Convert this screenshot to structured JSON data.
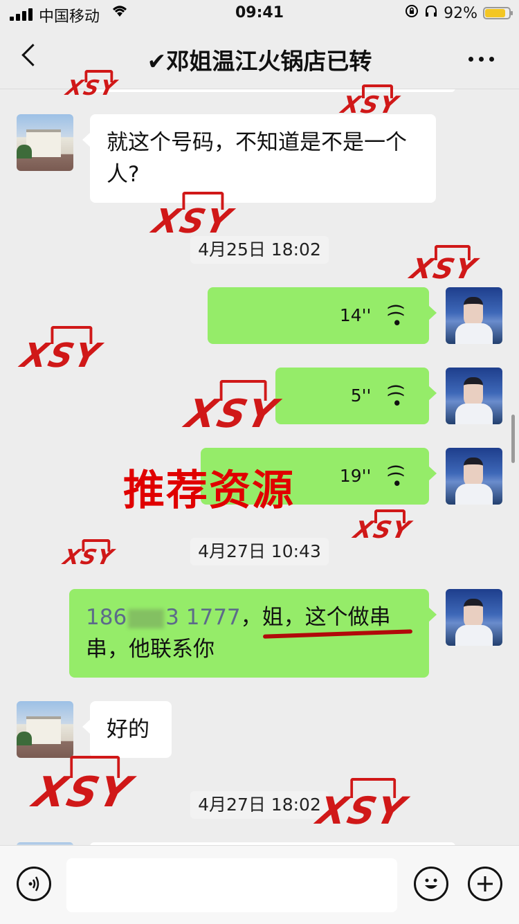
{
  "status_bar": {
    "carrier": "中国移动",
    "time": "09:41",
    "battery_percent": "92%",
    "battery_level": 0.92,
    "wifi_icon": "wifi-icon",
    "lock_icon": "rotation-lock-icon",
    "headphones_icon": "headphones-icon"
  },
  "nav": {
    "title": "✔邓姐温江火锅店已转"
  },
  "messages": [
    {
      "side": "in",
      "text": "就这个号码，不知道是不是一个人?"
    },
    {
      "timestamp": "4月25日 18:02"
    },
    {
      "side": "out",
      "type": "voice",
      "duration": "14''"
    },
    {
      "side": "out",
      "type": "voice",
      "duration": "5''"
    },
    {
      "side": "out",
      "type": "voice",
      "duration": "19''"
    },
    {
      "timestamp": "4月27日 10:43"
    },
    {
      "side": "out",
      "phone_prefix": "186",
      "phone_suffix": "3 1777",
      "text": "，姐，这个做串串，他联系你"
    },
    {
      "side": "in",
      "text": "好的"
    },
    {
      "timestamp": "4月27日 18:02"
    }
  ],
  "overlay": {
    "text": "推荐资源"
  },
  "watermark": {
    "text": "XSY",
    "color": "#d01818"
  },
  "input_bar": {
    "voice_button_icon": "voice-input-icon",
    "emoji_button_icon": "emoji-icon",
    "more_button_icon": "plus-icon"
  },
  "colors": {
    "outgoing_bubble": "#95ec69",
    "incoming_bubble": "#ffffff",
    "background": "#ededed",
    "overlay_red": "#e00000"
  }
}
